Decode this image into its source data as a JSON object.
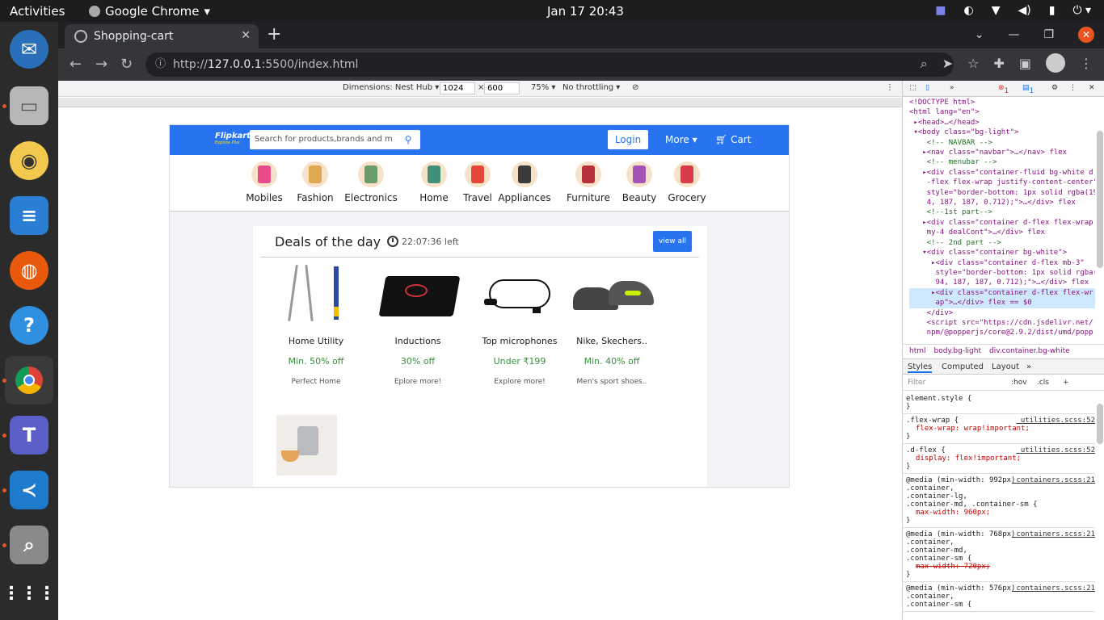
{
  "system": {
    "activities": "Activities",
    "app_name": "Google Chrome",
    "clock": "Jan 17  20:43"
  },
  "browser": {
    "tab_title": "Shopping-cart",
    "url_prefix": "http://",
    "url_host": "127.0.0.1",
    "url_path": ":5500/index.html"
  },
  "device_toolbar": {
    "dimensions_label": "Dimensions: Nest Hub ▾",
    "width": "1024",
    "times": "×",
    "height": "600",
    "zoom": "75% ▾",
    "throttling": "No throttling ▾"
  },
  "site": {
    "logo": "Flipkart",
    "logo_sub": "Explore Plus",
    "search_placeholder": "Search for products,brands and m",
    "login": "Login",
    "more": "More ▾",
    "cart": "Cart",
    "categories": [
      {
        "label": "Mobiles",
        "color": "#e94b8a"
      },
      {
        "label": "Fashion",
        "color": "#e0a94f"
      },
      {
        "label": "Electronics",
        "color": "#6c9b6a"
      },
      {
        "label": "Home",
        "color": "#3f8f7a"
      },
      {
        "label": "Travel",
        "color": "#e6463a"
      },
      {
        "label": "Appliances",
        "color": "#3b3b3b"
      },
      {
        "label": "Furniture",
        "color": "#b8323b"
      },
      {
        "label": "Beauty",
        "color": "#a453b8"
      },
      {
        "label": "Grocery",
        "color": "#d83b4a"
      }
    ],
    "deals": {
      "title": "Deals of the day",
      "timer": "22:07:36 left",
      "view_all": "view all",
      "products": [
        {
          "name": "Home Utility",
          "price": "Min. 50% off",
          "tag": "Perfect Home"
        },
        {
          "name": "Inductions",
          "price": "30% off",
          "tag": "Eplore more!"
        },
        {
          "name": "Top microphones",
          "price": "Under ₹199",
          "tag": "Explore more!"
        },
        {
          "name": "Nike, Skechers..",
          "price": "Min. 40% off",
          "tag": "Men's sport shoes.."
        }
      ]
    }
  },
  "devtools": {
    "errors": "1",
    "messages": "1",
    "breadcrumb": [
      "html",
      "body.bg-light",
      "div.container.bg-white"
    ],
    "style_tabs": [
      "Styles",
      "Computed",
      "Layout"
    ],
    "filter_placeholder": "Filter",
    "hov": ":hov",
    "cls": ".cls",
    "dom_lines": [
      "<!DOCTYPE html>",
      "<html lang=\"en\">",
      " ▸<head>…</head>",
      " ▾<body class=\"bg-light\">",
      "    <!-- NAVBAR -->",
      "   ▸<nav class=\"navbar\">…</nav> flex",
      "    <!-- menubar -->",
      "   ▸<div class=\"container-fluid bg-white d",
      "    -flex flex-wrap justify-content-center\"",
      "    style=\"border-bottom: 1px solid rgba(19",
      "    4, 187, 187, 0.712);\">…</div> flex",
      "    <!--1st part-->",
      "   ▸<div class=\"container d-flex flex-wrap",
      "    my-4 dealCont\">…</div> flex",
      "    <!-- 2nd part -->",
      "   ▾<div class=\"container bg-white\">",
      "     ▸<div class=\"container d-flex mb-3\"",
      "      style=\"border-bottom: 1px solid rgba(1",
      "      94, 187, 187, 0.712);\">…</div> flex",
      "     ▸<div class=\"container d-flex flex-wr",
      "      ap\">…</div> flex == $0",
      "    </div>",
      "    <script src=\"https://cdn.jsdelivr.net/",
      "    npm/@popperjs/core@2.9.2/dist/umd/popp"
    ],
    "rules": [
      {
        "selector": "element.style {",
        "source": "",
        "props": [],
        "close": "}"
      },
      {
        "selector": ".flex-wrap {",
        "source": "_utilities.scss:52",
        "props": [
          "flex-wrap: wrap!important;"
        ],
        "close": "}"
      },
      {
        "selector": ".d-flex {",
        "source": "_utilities.scss:52",
        "props": [
          "display: flex!important;"
        ],
        "close": "}"
      },
      {
        "selector": "@media (min-width: 992px)\n.container,\n.container-lg,\n.container-md, .container-sm {",
        "source": "_containers.scss:21",
        "props": [
          "max-width: 960px;"
        ],
        "close": "}"
      },
      {
        "selector": "@media (min-width: 768px)\n.container,\n.container-md,\n.container-sm {",
        "source": "_containers.scss:21",
        "props": [
          "max-width: 720px;"
        ],
        "close": "}"
      },
      {
        "selector": "@media (min-width: 576px)\n.container,\n.container-sm {",
        "source": "_containers.scss:21",
        "props": [],
        "close": ""
      }
    ]
  }
}
